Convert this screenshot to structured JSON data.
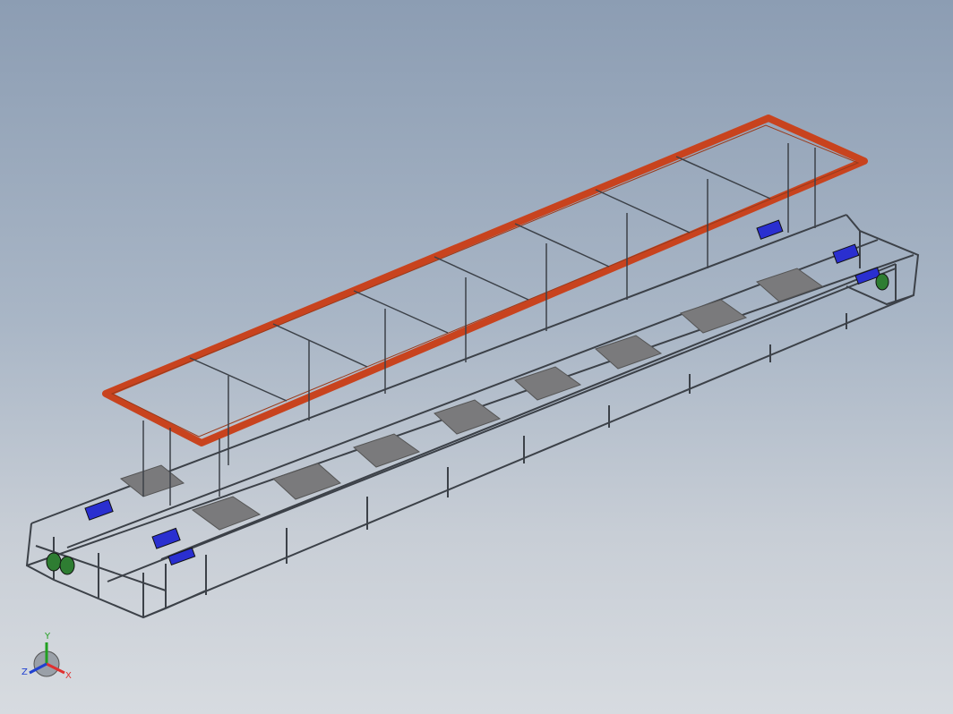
{
  "viewport": {
    "background_top": "#8c9db3",
    "background_bottom": "#d7dbe0",
    "model": "conveyor-line-assembly"
  },
  "triad": {
    "x_label": "X",
    "y_label": "Y",
    "z_label": "Z",
    "x_color": "#e03030",
    "y_color": "#22a022",
    "z_color": "#2040d0"
  },
  "colors": {
    "frame": "#3c4148",
    "top_frame": "#c8431e",
    "plate": "#7a7a7c",
    "motor": "#2a2fd0",
    "roller": "#2e7d32"
  }
}
